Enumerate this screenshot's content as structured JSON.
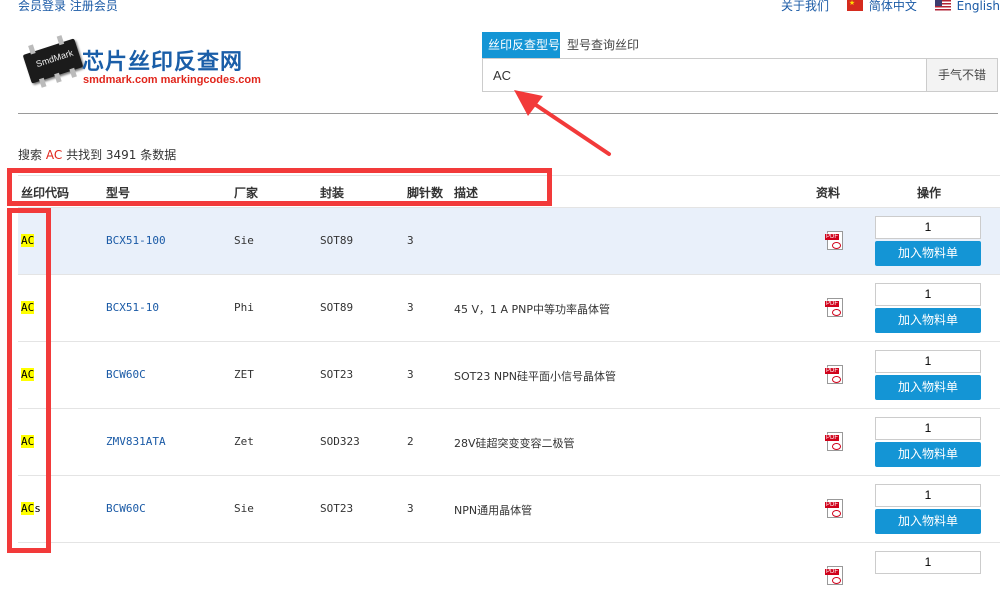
{
  "topbar": {
    "login": "会员登录",
    "register": "注册会员",
    "about": "关于我们",
    "lang_cn": "简体中文",
    "lang_en": "English"
  },
  "logo": {
    "chip_text": "SmdMark",
    "title": "芯片丝印反查网",
    "subtitle": "smdmark.com markingcodes.com"
  },
  "search": {
    "tab_active": "丝印反查型号",
    "tab_inactive": "型号查询丝印",
    "value": "AC",
    "luck_button": "手气不错"
  },
  "result": {
    "prefix": "搜索",
    "keyword": "AC",
    "middle": "共找到",
    "count": "3491",
    "suffix": "条数据"
  },
  "table": {
    "headers": {
      "code": "丝印代码",
      "model": "型号",
      "mfr": "厂家",
      "pkg": "封装",
      "pins": "脚针数",
      "desc": "描述",
      "datasheet": "资料",
      "action": "操作"
    },
    "add_label": "加入物料单",
    "rows": [
      {
        "code_hl": "AC",
        "code_rest": "",
        "model": "BCX51-100",
        "mfr": "Sie",
        "pkg": "SOT89",
        "pins": "3",
        "desc": "",
        "qty": "1"
      },
      {
        "code_hl": "AC",
        "code_rest": "",
        "model": "BCX51-10",
        "mfr": "Phi",
        "pkg": "SOT89",
        "pins": "3",
        "desc": "45 V，1 A PNP中等功率晶体管",
        "qty": "1"
      },
      {
        "code_hl": "AC",
        "code_rest": "",
        "model": "BCW60C",
        "mfr": "ZET",
        "pkg": "SOT23",
        "pins": "3",
        "desc": "SOT23 NPN硅平面小信号晶体管",
        "qty": "1"
      },
      {
        "code_hl": "AC",
        "code_rest": "",
        "model": "ZMV831ATA",
        "mfr": "Zet",
        "pkg": "SOD323",
        "pins": "2",
        "desc": "28V硅超突变变容二极管",
        "qty": "1"
      },
      {
        "code_hl": "AC",
        "code_rest": "s",
        "model": "BCW60C",
        "mfr": "Sie",
        "pkg": "SOT23",
        "pins": "3",
        "desc": "NPN通用晶体管",
        "qty": "1"
      },
      {
        "code_hl": "",
        "code_rest": "",
        "model": "",
        "mfr": "",
        "pkg": "",
        "pins": "",
        "desc": "",
        "qty": "1"
      }
    ]
  },
  "colors": {
    "accent": "#1495d5",
    "link": "#1a5aa6",
    "highlight": "#ffff00",
    "annotation": "#f23a3a"
  }
}
